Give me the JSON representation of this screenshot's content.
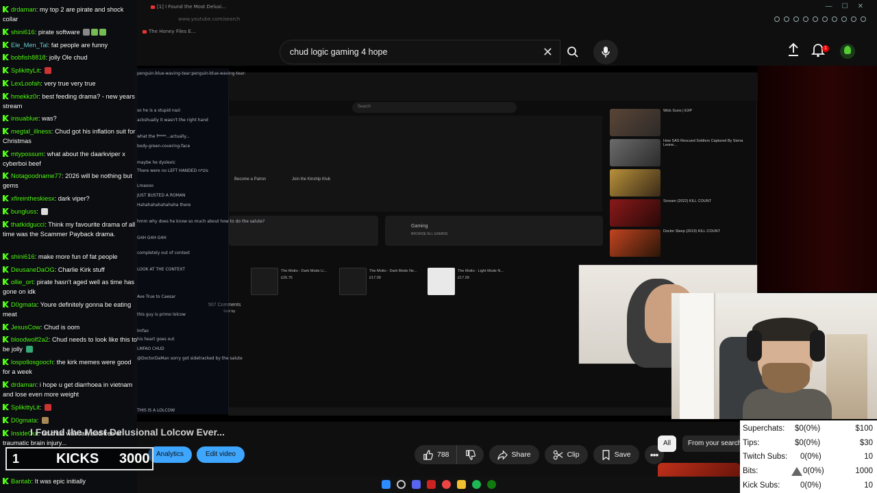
{
  "search": {
    "query": "chud logic gaming 4 hope"
  },
  "browser": {
    "tabs": [
      "[1] I Found the Most Delusi...",
      "The Honey Files E..."
    ],
    "url": "www.youtube.com/search"
  },
  "youtube": {
    "logo": "Premium"
  },
  "notifications": {
    "count": "1"
  },
  "chat": [
    {
      "user": "drdaman",
      "text": "my top 2 are pirate and shock collar"
    },
    {
      "user": "shini616",
      "text": "pirate software"
    },
    {
      "user": "Ele_Men_Tal",
      "text": "fat people are funny"
    },
    {
      "user": "bobfish8818",
      "text": "jolly Ole chud"
    },
    {
      "user": "SplikittyLit",
      "text": ""
    },
    {
      "user": "LexLoofah",
      "text": "very true very true"
    },
    {
      "user": "hmekkz0r",
      "text": "best feeding drama? - new years stream"
    },
    {
      "user": "insuablue",
      "text": "was?"
    },
    {
      "user": "megtal_illness",
      "text": "Chud got his inflation suit for Christmas"
    },
    {
      "user": "mtypossum",
      "text": "what about the daarkviper x cyberboi beef"
    },
    {
      "user": "Notagoodname77",
      "text": "2026 will be nothing but gems"
    },
    {
      "user": "xfireintheskiesx",
      "text": "dark viper?"
    },
    {
      "user": "bungluss",
      "text": ""
    },
    {
      "user": "thatkidgucci",
      "text": "Think my favourite drama of all time was the Scammer Payback drama."
    },
    {
      "user": "shini616",
      "text": "make more fun of fat people"
    },
    {
      "user": "DeusaneDaOG",
      "text": "Charlie Kirk stuff"
    },
    {
      "user": "ollie_ort",
      "text": "pirate hasn't aged well as time has gone on idk"
    },
    {
      "user": "D0gmata",
      "text": "Youre definitely gonna be eating meat"
    },
    {
      "user": "JesusCow",
      "text": "Chud is oom"
    },
    {
      "user": "bloodwolf2a2",
      "text": "Chud needs to look like this to be jolly"
    },
    {
      "user": "lospollosgooch",
      "text": "the kirk memes were good for a week"
    },
    {
      "user": "drdaman",
      "text": "i hope u get diarrhoea in vietnam and lose even more weight"
    },
    {
      "user": "SplikittyLit",
      "text": ""
    },
    {
      "user": "D0gmata",
      "text": ""
    },
    {
      "user": "InsideOut",
      "text": "fat chud was fail, and free of traumatic brain injury..."
    },
    {
      "user": "Bantab",
      "text": "It was epic initially"
    }
  ],
  "ghost_chat": [
    "penguin-blue-waving-tear:penguin-blue-waving-tear:",
    "so he is a stupid nazi",
    "ackshually it wasn't the right hand",
    "what the f****...actually...",
    "body-green-covering-face",
    "maybe he dyslexic",
    "There were no LEFT HANDED n*zis",
    "Lmaooo",
    "JUST BUSTED A ROMAN",
    "Hahahahahahahaha there",
    "hmm why does he know so much about how to do the salute?",
    "G4H G4H G4H",
    "completely out of context",
    "LOOK AT THE CONTEXT",
    "Ave True to Caesar",
    "this guy is primo lolcow",
    "lmfao",
    "his heart goes out",
    "LMFAO CHUD",
    "@DoctorDaMan sorry got sidetracked by the salute",
    "THIS IS A LOLCOW"
  ],
  "video": {
    "title": "I Found the Most Delusional Lolcow Ever...",
    "analytics_label": "Analytics",
    "edit_label": "Edit video",
    "likes": "788",
    "share_label": "Share",
    "clip_label": "Clip",
    "save_label": "Save"
  },
  "filters": {
    "all": "All",
    "yours": "From your search"
  },
  "kicks": {
    "rank": "1",
    "label": "KICKS",
    "count": "3000"
  },
  "inner_page": {
    "search_placeholder": "Search",
    "patron": "Become a Patron",
    "kinship": "Join the Kinship Klub",
    "gaming": "Gaming",
    "browse": "BROWSE ALL GAMING",
    "comments": "507 Comments",
    "sort": "Sort by",
    "merch": [
      {
        "name": "The Motto - Dark Mode Li...",
        "price": "£26.75"
      },
      {
        "name": "The Motto - Dark Mode Ne...",
        "price": "£17.09"
      },
      {
        "name": "The Motto - Light Mode N...",
        "price": "£17.09"
      }
    ],
    "sidebar": [
      "Wick Guns | EXP",
      "How SAS Rescued Soldiers Captured By Sierra Leone...",
      "Scream (2022) KILL COUNT",
      "Doctor Sleep (2019) KILL COUNT"
    ]
  },
  "donations": [
    {
      "label": "Superchats:",
      "value": "$0(0%)",
      "goal": "$100"
    },
    {
      "label": "Tips:",
      "value": "$0(0%)",
      "goal": "$30"
    },
    {
      "label": "Twitch Subs:",
      "value": "0(0%)",
      "goal": "10"
    },
    {
      "label": "Bits:",
      "value": "0(0%)",
      "goal": "1000"
    },
    {
      "label": "Kick Subs:",
      "value": "0(0%)",
      "goal": "10"
    }
  ]
}
